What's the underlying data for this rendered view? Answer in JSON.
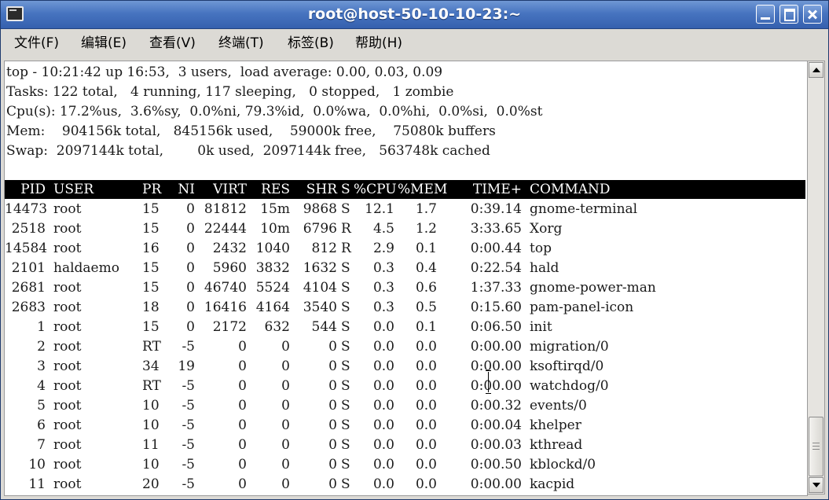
{
  "window": {
    "title": "root@host-50-10-10-23:~",
    "app_icon": "terminal-icon",
    "controls": [
      "minimize-icon",
      "maximize-icon",
      "close-icon"
    ]
  },
  "menu": {
    "items": [
      "文件(F)",
      "编辑(E)",
      "查看(V)",
      "终端(T)",
      "标签(B)",
      "帮助(H)"
    ]
  },
  "summary": {
    "lines": [
      "top - 10:21:42 up 16:53,  3 users,  load average: 0.00, 0.03, 0.09",
      "Tasks: 122 total,   4 running, 117 sleeping,   0 stopped,   1 zombie",
      "Cpu(s): 17.2%us,  3.6%sy,  0.0%ni, 79.3%id,  0.0%wa,  0.0%hi,  0.0%si,  0.0%st",
      "Mem:    904156k total,   845156k used,    59000k free,    75080k buffers",
      "Swap:  2097144k total,        0k used,  2097144k free,   563748k cached"
    ]
  },
  "table": {
    "headers": [
      "PID",
      "USER",
      "PR",
      "NI",
      "VIRT",
      "RES",
      "SHR",
      "S",
      "%CPU",
      "%MEM",
      "TIME+",
      "COMMAND"
    ],
    "rows": [
      [
        "14473",
        "root",
        "15",
        "0",
        "81812",
        "15m",
        "9868",
        "S",
        "12.1",
        "1.7",
        "0:39.14",
        "gnome-terminal"
      ],
      [
        "2518",
        "root",
        "15",
        "0",
        "22444",
        "10m",
        "6796",
        "R",
        "4.5",
        "1.2",
        "3:33.65",
        "Xorg"
      ],
      [
        "14584",
        "root",
        "16",
        "0",
        "2432",
        "1040",
        "812",
        "R",
        "2.9",
        "0.1",
        "0:00.44",
        "top"
      ],
      [
        "2101",
        "haldaemo",
        "15",
        "0",
        "5960",
        "3832",
        "1632",
        "S",
        "0.3",
        "0.4",
        "0:22.54",
        "hald"
      ],
      [
        "2681",
        "root",
        "15",
        "0",
        "46740",
        "5524",
        "4104",
        "S",
        "0.3",
        "0.6",
        "1:37.33",
        "gnome-power-man"
      ],
      [
        "2683",
        "root",
        "18",
        "0",
        "16416",
        "4164",
        "3540",
        "S",
        "0.3",
        "0.5",
        "0:15.60",
        "pam-panel-icon"
      ],
      [
        "1",
        "root",
        "15",
        "0",
        "2172",
        "632",
        "544",
        "S",
        "0.0",
        "0.1",
        "0:06.50",
        "init"
      ],
      [
        "2",
        "root",
        "RT",
        "-5",
        "0",
        "0",
        "0",
        "S",
        "0.0",
        "0.0",
        "0:00.00",
        "migration/0"
      ],
      [
        "3",
        "root",
        "34",
        "19",
        "0",
        "0",
        "0",
        "S",
        "0.0",
        "0.0",
        "0:00.00",
        "ksoftirqd/0"
      ],
      [
        "4",
        "root",
        "RT",
        "-5",
        "0",
        "0",
        "0",
        "S",
        "0.0",
        "0.0",
        "0:00.00",
        "watchdog/0"
      ],
      [
        "5",
        "root",
        "10",
        "-5",
        "0",
        "0",
        "0",
        "S",
        "0.0",
        "0.0",
        "0:00.32",
        "events/0"
      ],
      [
        "6",
        "root",
        "10",
        "-5",
        "0",
        "0",
        "0",
        "S",
        "0.0",
        "0.0",
        "0:00.04",
        "khelper"
      ],
      [
        "7",
        "root",
        "11",
        "-5",
        "0",
        "0",
        "0",
        "S",
        "0.0",
        "0.0",
        "0:00.03",
        "kthread"
      ],
      [
        "10",
        "root",
        "10",
        "-5",
        "0",
        "0",
        "0",
        "S",
        "0.0",
        "0.0",
        "0:00.50",
        "kblockd/0"
      ],
      [
        "11",
        "root",
        "20",
        "-5",
        "0",
        "0",
        "0",
        "S",
        "0.0",
        "0.0",
        "0:00.00",
        "kacpid"
      ]
    ]
  },
  "scrollbar": {
    "up_icon": "arrow-up-icon",
    "down_icon": "arrow-down-icon"
  },
  "colors": {
    "titlebar": "#4774c0",
    "header_bar": "#000000",
    "terminal_bg": "#ffffff"
  }
}
